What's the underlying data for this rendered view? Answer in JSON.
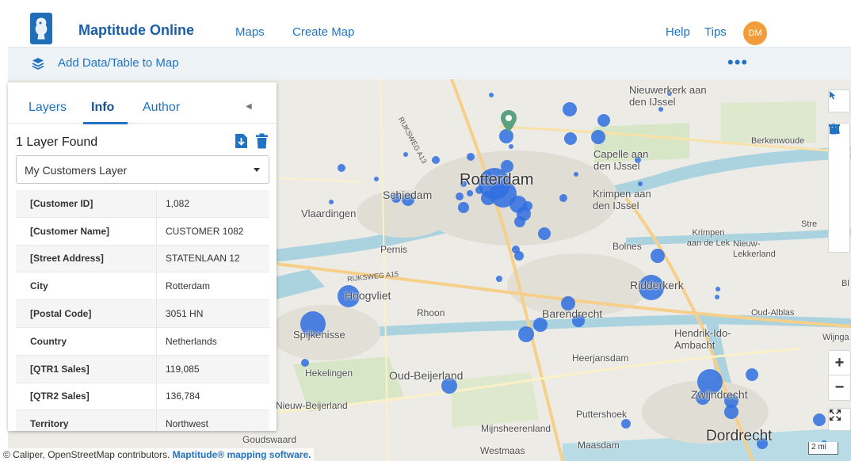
{
  "nav": {
    "brand": "Maptitude Online",
    "links": [
      "Maps",
      "Create Map"
    ],
    "help": "Help",
    "tips": "Tips",
    "avatar_initials": "DM",
    "accent": "#1f73c2",
    "avatar_color": "#f29d3b"
  },
  "toolbar": {
    "add_data_label": "Add Data/Table to Map",
    "more_label": "•••"
  },
  "panel": {
    "tabs": [
      "Layers",
      "Info",
      "Author"
    ],
    "active_tab": "Info",
    "found_text": "1 Layer Found",
    "selected_layer": "My Customers Layer",
    "fields": [
      {
        "key": "[Customer ID]",
        "value": "1,082"
      },
      {
        "key": "[Customer Name]",
        "value": "CUSTOMER 1082"
      },
      {
        "key": "[Street Address]",
        "value": "STATENLAAN 12"
      },
      {
        "key": "City",
        "value": "Rotterdam"
      },
      {
        "key": "[Postal Code]",
        "value": "3051 HN"
      },
      {
        "key": "Country",
        "value": "Netherlands"
      },
      {
        "key": "[QTR1 Sales]",
        "value": "119,085"
      },
      {
        "key": "[QTR2 Sales]",
        "value": "136,784"
      },
      {
        "key": "Territory",
        "value": "Northwest"
      }
    ]
  },
  "map": {
    "places": {
      "rotterdam": "Rotterdam",
      "schiedam": "Schiedam",
      "vlaardingen": "Vlaardingen",
      "pernis": "Pernis",
      "hoogvliet": "Hoogvliet",
      "spijkenisse": "Spijkenisse",
      "rhoon": "Rhoon",
      "hekelingen": "Hekelingen",
      "oud_beijerland": "Oud-Beijerland",
      "nieuw_beijerland": "Nieuw-Beijerland",
      "goudswaard": "Goudswaard",
      "mijnsheerenland": "Mijnsheerenland",
      "westmaas": "Westmaas",
      "maasdam": "Maasdam",
      "puttershoek": "Puttershoek",
      "barendrecht": "Barendrecht",
      "ridderkerk": "Ridderkerk",
      "bolnes": "Bolnes",
      "krimpen_lek": "Krimpen aan de Lek",
      "nieuw_lekkerland": "Nieuw-Lekkerland",
      "krimpen_ijssel": "Krimpen aan den IJssel",
      "capelle": "Capelle aan den IJssel",
      "nieuwerkerk": "Nieuwerkerk aan den IJssel",
      "berkenwoude": "Berkenwoude",
      "oud_alblas": "Oud-Alblas",
      "hendrik_ido": "Hendrik-Ido-Ambacht",
      "heerjansdam": "Heerjansdam",
      "zwijndrecht": "Zwijndrecht",
      "dordrecht": "Dordrecht",
      "wijnga": "Wijnga",
      "stre": "Stre",
      "bl": "Bl"
    },
    "roads": [
      "RIJKSWEG A13",
      "RIJKSWEG A15"
    ],
    "attribution": "© Caliper, OpenStreetMap contributors.",
    "attribution_link": "Maptitude® mapping software.",
    "scale_label": "2 mi",
    "bubble_color": "#2f6fe0",
    "marker_color": "#5aa17f"
  },
  "controls": {
    "zoom_in": "+",
    "zoom_out": "−"
  }
}
